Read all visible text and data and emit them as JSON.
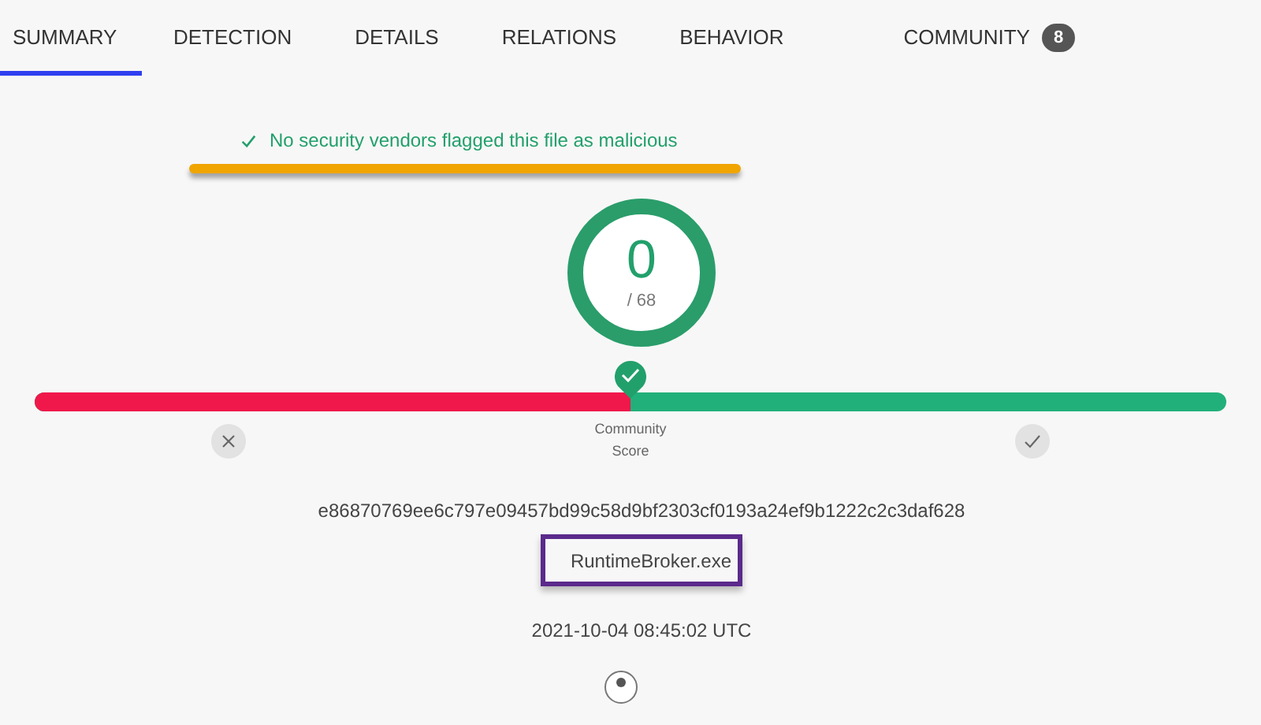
{
  "tabs": [
    {
      "label": "SUMMARY",
      "selected": true
    },
    {
      "label": "DETECTION",
      "selected": false
    },
    {
      "label": "DETAILS",
      "selected": false
    },
    {
      "label": "RELATIONS",
      "selected": false
    },
    {
      "label": "BEHAVIOR",
      "selected": false
    },
    {
      "label": "COMMUNITY",
      "selected": false,
      "badge": "8"
    }
  ],
  "verdict": {
    "message": "No security vendors flagged this file as malicious",
    "highlighted": true
  },
  "detection_score": {
    "value": "0",
    "total": "/ 68",
    "level": 0
  },
  "community_score": {
    "label": "Community Score",
    "level": 0.5
  },
  "file": {
    "hash": "e86870769ee6c797e09457bd99c58d9bf2303cf0193a24ef9b1222c2c3daf628",
    "name": "RuntimeBroker.exe",
    "name_highlighted": true,
    "date": "2021-10-04 08:45:02 UTC"
  }
}
